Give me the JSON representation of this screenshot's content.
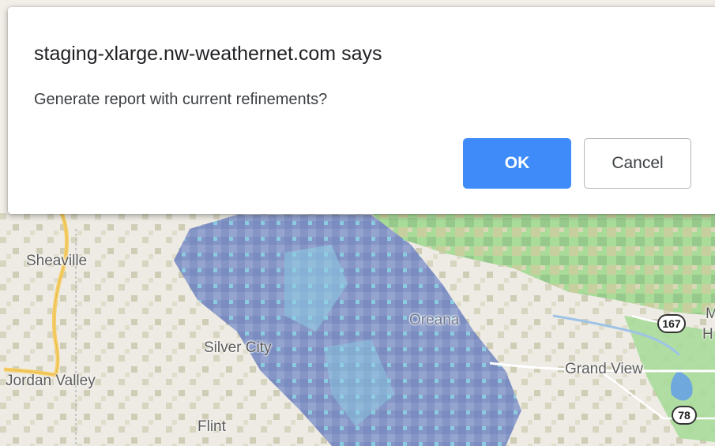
{
  "dialog": {
    "title": "staging-xlarge.nw-weathernet.com says",
    "message": "Generate report with current refinements?",
    "ok_label": "OK",
    "cancel_label": "Cancel",
    "ok_color": "#3f8bfa"
  },
  "map": {
    "places": {
      "sheaville": "Sheaville",
      "silver_city": "Silver City",
      "jordan_valley": "Jordan Valley",
      "flint": "Flint",
      "oreana": "Oreana",
      "grand_view": "Grand View",
      "partial_m": "M",
      "partial_h": "H"
    },
    "routes": {
      "route_167": "167",
      "route_78": "78"
    },
    "colors": {
      "land": "#f2efe9",
      "vegetation": "#a8dc9a",
      "radar_dark": "#7d8fc2",
      "radar_light": "#8fd0e4",
      "highway": "#f6cf6a",
      "water": "#6fa8dc"
    }
  }
}
